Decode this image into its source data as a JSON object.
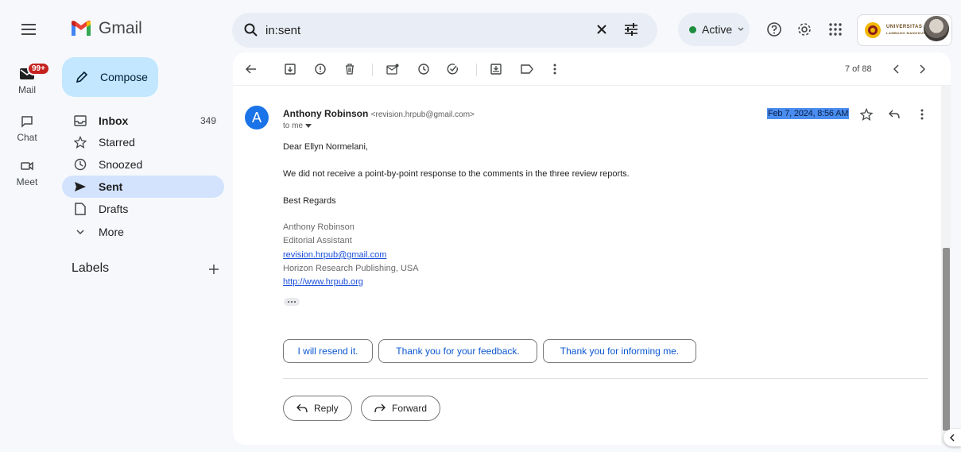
{
  "app": {
    "name": "Gmail"
  },
  "search": {
    "value": "in:sent"
  },
  "status": {
    "label": "Active"
  },
  "org": {
    "logo_text_1": "UNIVERSITAS",
    "logo_text_2": "LAMBUNG MANGKURAT"
  },
  "rail": {
    "mail_label": "Mail",
    "mail_badge": "99+",
    "chat_label": "Chat",
    "meet_label": "Meet"
  },
  "nav": {
    "compose": "Compose",
    "items": [
      {
        "label": "Inbox",
        "count": "349"
      },
      {
        "label": "Starred",
        "count": ""
      },
      {
        "label": "Snoozed",
        "count": ""
      },
      {
        "label": "Sent",
        "count": ""
      },
      {
        "label": "Drafts",
        "count": ""
      },
      {
        "label": "More",
        "count": ""
      }
    ],
    "labels_heading": "Labels"
  },
  "toolbar": {
    "pager": "7 of 88"
  },
  "message": {
    "sender_initial": "A",
    "sender_name": "Anthony Robinson",
    "sender_email": "<revision.hrpub@gmail.com>",
    "to": "to me",
    "date": "Feb 7, 2024, 8:56 AM",
    "greeting": "Dear Ellyn Normelani,",
    "body": "We did not receive a point-by-point response to the comments in the three review reports.",
    "closing": "Best Regards",
    "signature": {
      "name": "Anthony Robinson",
      "title": "Editorial Assistant",
      "email": "revision.hrpub@gmail.com",
      "company": "Horizon Research Publishing, USA",
      "website": "http://www.hrpub.org"
    }
  },
  "smart_replies": [
    "I will resend it.",
    "Thank you for your feedback.",
    "Thank you for informing me."
  ],
  "actions": {
    "reply": "Reply",
    "forward": "Forward"
  },
  "colors": {
    "accent": "#0b57d0",
    "compose_bg": "#c2e7ff",
    "selected_nav": "#d3e3fd",
    "badge": "#c5221f",
    "active_dot": "#1e8e3e",
    "avatar_bg": "#1a73e8"
  }
}
